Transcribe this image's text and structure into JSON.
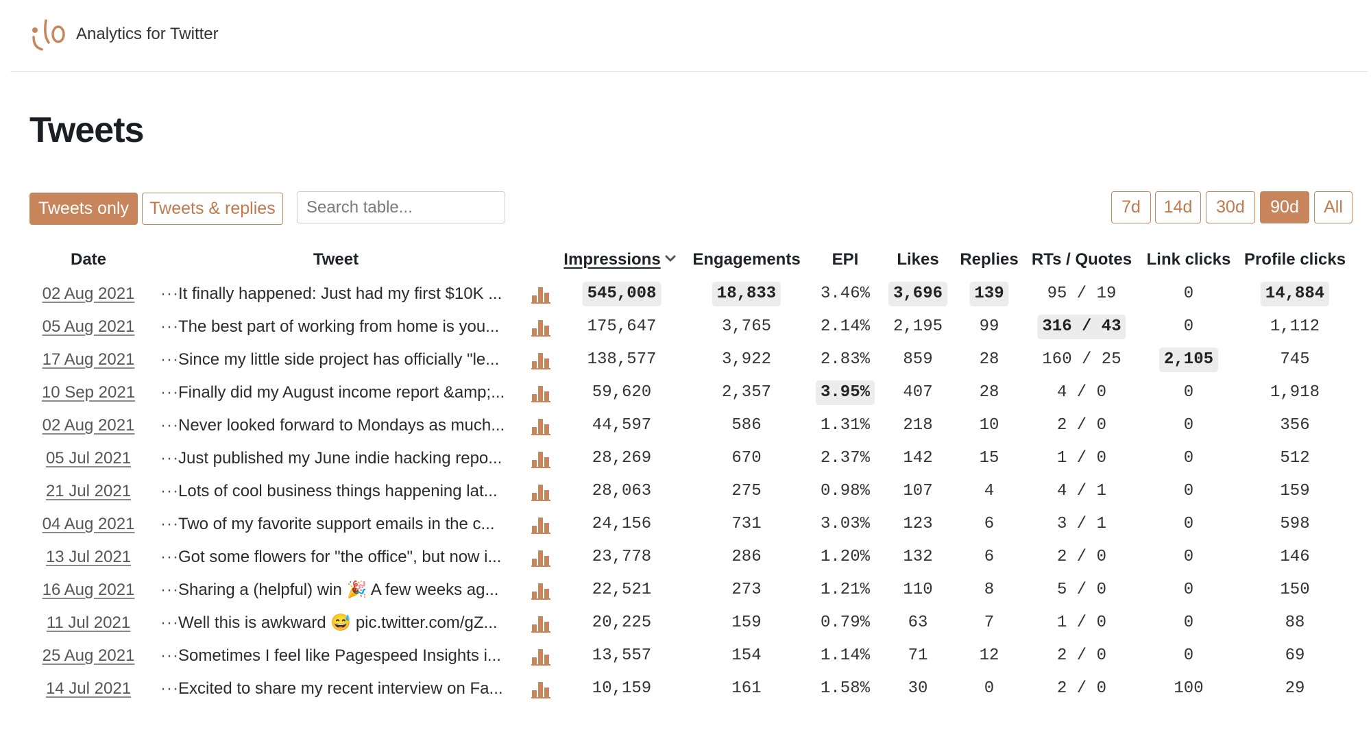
{
  "app": {
    "title": "Analytics for Twitter"
  },
  "page": {
    "title": "Tweets"
  },
  "filters": {
    "tweets_only": "Tweets only",
    "tweets_replies": "Tweets & replies",
    "active": "Tweets only"
  },
  "search": {
    "placeholder": "Search table..."
  },
  "ranges": {
    "d7": "7d",
    "d14": "14d",
    "d30": "30d",
    "d90": "90d",
    "all": "All",
    "active": "90d"
  },
  "table": {
    "headers": {
      "date": "Date",
      "tweet": "Tweet",
      "impressions": "Impressions",
      "engagements": "Engagements",
      "epi": "EPI",
      "likes": "Likes",
      "replies": "Replies",
      "rts_quotes": "RTs / Quotes",
      "link_clicks": "Link clicks",
      "profile_clicks": "Profile clicks"
    },
    "sort_column": "Impressions",
    "rows": [
      {
        "date": "02 Aug 2021",
        "dots": "···",
        "tweet": "It finally happened: Just had my first $10K ...",
        "impressions": "545,008",
        "engagements": "18,833",
        "epi": "3.46%",
        "likes": "3,696",
        "replies": "139",
        "rts": "95 / 19",
        "link_clicks": "0",
        "profile_clicks": "14,884"
      },
      {
        "date": "05 Aug 2021",
        "dots": "···",
        "tweet": "The best part of working from home is you...",
        "impressions": "175,647",
        "engagements": "3,765",
        "epi": "2.14%",
        "likes": "2,195",
        "replies": "99",
        "rts": "316 / 43",
        "link_clicks": "0",
        "profile_clicks": "1,112"
      },
      {
        "date": "17 Aug 2021",
        "dots": "···",
        "tweet": "Since my little side project has officially \"le...",
        "impressions": "138,577",
        "engagements": "3,922",
        "epi": "2.83%",
        "likes": "859",
        "replies": "28",
        "rts": "160 / 25",
        "link_clicks": "2,105",
        "profile_clicks": "745"
      },
      {
        "date": "10 Sep 2021",
        "dots": "···",
        "tweet": "Finally did my August income report &amp;...",
        "impressions": "59,620",
        "engagements": "2,357",
        "epi": "3.95%",
        "likes": "407",
        "replies": "28",
        "rts": "4 / 0",
        "link_clicks": "0",
        "profile_clicks": "1,918"
      },
      {
        "date": "02 Aug 2021",
        "dots": "···",
        "tweet": "Never looked forward to Mondays as much...",
        "impressions": "44,597",
        "engagements": "586",
        "epi": "1.31%",
        "likes": "218",
        "replies": "10",
        "rts": "2 / 0",
        "link_clicks": "0",
        "profile_clicks": "356"
      },
      {
        "date": "05 Jul 2021",
        "dots": "···",
        "tweet": "Just published my June indie hacking repo...",
        "impressions": "28,269",
        "engagements": "670",
        "epi": "2.37%",
        "likes": "142",
        "replies": "15",
        "rts": "1 / 0",
        "link_clicks": "0",
        "profile_clicks": "512"
      },
      {
        "date": "21 Jul 2021",
        "dots": "···",
        "tweet": "Lots of cool business things happening lat...",
        "impressions": "28,063",
        "engagements": "275",
        "epi": "0.98%",
        "likes": "107",
        "replies": "4",
        "rts": "4 / 1",
        "link_clicks": "0",
        "profile_clicks": "159"
      },
      {
        "date": "04 Aug 2021",
        "dots": "···",
        "tweet": "Two of my favorite support emails in the c...",
        "impressions": "24,156",
        "engagements": "731",
        "epi": "3.03%",
        "likes": "123",
        "replies": "6",
        "rts": "3 / 1",
        "link_clicks": "0",
        "profile_clicks": "598"
      },
      {
        "date": "13 Jul 2021",
        "dots": "···",
        "tweet": "Got some flowers for \"the office\", but now i...",
        "impressions": "23,778",
        "engagements": "286",
        "epi": "1.20%",
        "likes": "132",
        "replies": "6",
        "rts": "2 / 0",
        "link_clicks": "0",
        "profile_clicks": "146"
      },
      {
        "date": "16 Aug 2021",
        "dots": "···",
        "tweet": "Sharing a (helpful) win 🎉  A few weeks ag...",
        "impressions": "22,521",
        "engagements": "273",
        "epi": "1.21%",
        "likes": "110",
        "replies": "8",
        "rts": "5 / 0",
        "link_clicks": "0",
        "profile_clicks": "150"
      },
      {
        "date": "11 Jul 2021",
        "dots": "···",
        "tweet": "Well this is awkward 😅  pic.twitter.com/gZ...",
        "impressions": "20,225",
        "engagements": "159",
        "epi": "0.79%",
        "likes": "63",
        "replies": "7",
        "rts": "1 / 0",
        "link_clicks": "0",
        "profile_clicks": "88"
      },
      {
        "date": "25 Aug 2021",
        "dots": "···",
        "tweet": "Sometimes I feel like Pagespeed Insights i...",
        "impressions": "13,557",
        "engagements": "154",
        "epi": "1.14%",
        "likes": "71",
        "replies": "12",
        "rts": "2 / 0",
        "link_clicks": "0",
        "profile_clicks": "69"
      },
      {
        "date": "14 Jul 2021",
        "dots": "···",
        "tweet": "Excited to share my recent interview on Fa...",
        "impressions": "10,159",
        "engagements": "161",
        "epi": "1.58%",
        "likes": "30",
        "replies": "0",
        "rts": "2 / 0",
        "link_clicks": "100",
        "profile_clicks": "29"
      }
    ],
    "highlighted_cells": [
      {
        "row": 0,
        "col": "impressions"
      },
      {
        "row": 0,
        "col": "engagements"
      },
      {
        "row": 0,
        "col": "likes"
      },
      {
        "row": 0,
        "col": "replies"
      },
      {
        "row": 0,
        "col": "profile_clicks"
      },
      {
        "row": 1,
        "col": "rts"
      },
      {
        "row": 2,
        "col": "link_clicks"
      },
      {
        "row": 3,
        "col": "epi"
      }
    ]
  },
  "colors": {
    "accent": "#c8855b",
    "highlight_bg": "#ececec"
  },
  "icons": {
    "row_stats": "bar-chart-icon",
    "sort": "chevron-down-icon",
    "logo": "logo-icon"
  }
}
